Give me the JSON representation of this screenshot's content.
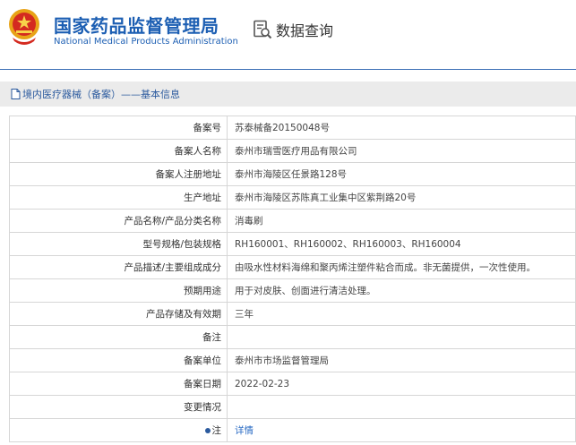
{
  "header": {
    "logo_cn": "国家药品监督管理局",
    "logo_en": "National Medical Products Administration",
    "page_title": "数据查询"
  },
  "breadcrumb": "境内医疗器械（备案）——基本信息",
  "rows": [
    {
      "label": "备案号",
      "value": "苏泰械备20150048号"
    },
    {
      "label": "备案人名称",
      "value": "泰州市瑞雪医疗用品有限公司"
    },
    {
      "label": "备案人注册地址",
      "value": "泰州市海陵区任景路128号"
    },
    {
      "label": "生产地址",
      "value": "泰州市海陵区苏陈真工业集中区紫荆路20号"
    },
    {
      "label": "产品名称/产品分类名称",
      "value": "消毒刷"
    },
    {
      "label": "型号规格/包装规格",
      "value": "RH160001、RH160002、RH160003、RH160004"
    },
    {
      "label": "产品描述/主要组成成分",
      "value": "由吸水性材料海绵和聚丙烯注塑件粘合而成。非无菌提供，一次性使用。"
    },
    {
      "label": "预期用途",
      "value": "用于对皮肤、创面进行清洁处理。"
    },
    {
      "label": "产品存储及有效期",
      "value": "三年"
    },
    {
      "label": "备注",
      "value": ""
    },
    {
      "label": "备案单位",
      "value": "泰州市市场监督管理局"
    },
    {
      "label": "备案日期",
      "value": "2022-02-23"
    },
    {
      "label": "变更情况",
      "value": ""
    }
  ],
  "note": {
    "label": "注",
    "link_text": "详情"
  },
  "colors": {
    "brand_blue": "#1d5fb3",
    "link_blue": "#2b6cc4",
    "crumb_bg": "#ebebeb",
    "border": "#d6d6d6"
  }
}
